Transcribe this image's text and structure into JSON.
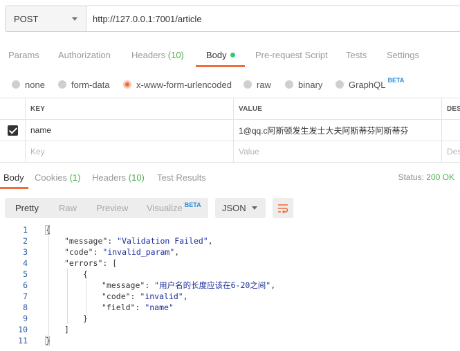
{
  "request": {
    "method": "POST",
    "url": "http://127.0.0.1:7001/article"
  },
  "request_tabs": [
    {
      "label": "Params"
    },
    {
      "label": "Authorization"
    },
    {
      "label": "Headers",
      "count": "(10)"
    },
    {
      "label": "Body",
      "active": true
    },
    {
      "label": "Pre-request Script"
    },
    {
      "label": "Tests"
    },
    {
      "label": "Settings"
    }
  ],
  "body_types": {
    "none": "none",
    "form_data": "form-data",
    "urlencoded": "x-www-form-urlencoded",
    "raw": "raw",
    "binary": "binary",
    "graphql": "GraphQL",
    "beta": "BETA",
    "selected": "x-www-form-urlencoded"
  },
  "kv_table": {
    "headers": {
      "key": "KEY",
      "value": "VALUE",
      "description": "DESC"
    },
    "rows": [
      {
        "checked": true,
        "key": "name",
        "value": "1@qq.c阿斯顿发生发士大夫阿斯蒂芬阿斯蒂芬"
      }
    ],
    "placeholder": {
      "key": "Key",
      "value": "Value",
      "description": "Des"
    }
  },
  "response_tabs": [
    {
      "label": "Body",
      "active": true
    },
    {
      "label": "Cookies",
      "count": "(1)"
    },
    {
      "label": "Headers",
      "count": "(10)"
    },
    {
      "label": "Test Results"
    }
  ],
  "status": {
    "label": "Status:",
    "value": "200 OK",
    "color": "#4caf50"
  },
  "view_modes": {
    "pretty": "Pretty",
    "raw": "Raw",
    "preview": "Preview",
    "visualize": "Visualize",
    "beta": "BETA"
  },
  "format": "JSON",
  "colors": {
    "accent": "#f26b3a",
    "count": "#4caf50",
    "beta": "#2c8dd6"
  },
  "code": {
    "line_numbers": [
      "1",
      "2",
      "3",
      "4",
      "5",
      "6",
      "7",
      "8",
      "9",
      "10",
      "11"
    ],
    "lines": {
      "l1": "{",
      "l2_key": "\"message\"",
      "l2_val": "\"Validation Failed\"",
      "l3_key": "\"code\"",
      "l3_val": "\"invalid_param\"",
      "l4_key": "\"errors\"",
      "l4_rest": ": [",
      "l5": "{",
      "l6_key": "\"message\"",
      "l6_val": "\"用户名的长度应该在6-20之间\"",
      "l7_key": "\"code\"",
      "l7_val": "\"invalid\"",
      "l8_key": "\"field\"",
      "l8_val": "\"name\"",
      "l9": "}",
      "l10": "]",
      "l11": "}"
    }
  }
}
